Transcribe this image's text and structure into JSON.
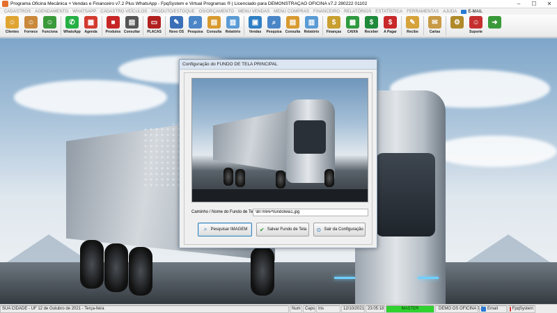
{
  "window": {
    "title": "Programa Oficina Mecânica + Vendas e Financeiro v7.2 Plus WhatsApp - FpqSystem e Virtual Programas ® | Licenciado para  DEMONSTRAÇÃO OFICINA v7.2 280222 01102",
    "minimize": "–",
    "maximize": "☐",
    "close": "✕"
  },
  "menu": [
    "CADASTROS",
    "AGENDAMENTO",
    "WHATSAPP",
    "CADASTRO VEÍCULOS",
    "PRODUTO/ESTOQUE",
    "OS/ORÇAMENTO",
    "MENU VENDAS",
    "MENU COMPRAS",
    "FINANCEIRO",
    "RELATÓRIOS",
    "ESTATÍSTICA",
    "FERRAMENTAS",
    "AJUDA"
  ],
  "menu_email": "E-MAIL",
  "toolbar": [
    {
      "label": "Clientes",
      "icon": "clients-icon",
      "color": "#e0a431",
      "glyph": "☺"
    },
    {
      "label": "Fornece",
      "icon": "supplier-icon",
      "color": "#c9883b",
      "glyph": "☺"
    },
    {
      "label": "Funciona",
      "icon": "employee-icon",
      "color": "#3a9a3a",
      "glyph": "☺"
    },
    {
      "sep": true
    },
    {
      "label": "WhatsApp",
      "icon": "whatsapp-icon",
      "color": "#25b045",
      "glyph": "✆"
    },
    {
      "label": "Agenda",
      "icon": "calendar-icon",
      "color": "#d33b2f",
      "glyph": "▦"
    },
    {
      "sep": true
    },
    {
      "label": "Produtos",
      "icon": "products-icon",
      "color": "#c72626",
      "glyph": "■"
    },
    {
      "label": "Consultar",
      "icon": "consult-icon",
      "color": "#555555",
      "glyph": "▤"
    },
    {
      "sep": true
    },
    {
      "label": "PLACAS",
      "icon": "plates-icon",
      "color": "#b22020",
      "glyph": "▭"
    },
    {
      "sep": true
    },
    {
      "label": "Novo OS",
      "icon": "new-os-icon",
      "color": "#3a6fb8",
      "glyph": "✎"
    },
    {
      "label": "Pesquisa",
      "icon": "search-icon",
      "color": "#4a86c7",
      "glyph": "⌕"
    },
    {
      "label": "Consulta",
      "icon": "consult-os-icon",
      "color": "#d89a2f",
      "glyph": "▤"
    },
    {
      "label": "Relatório",
      "icon": "report-icon",
      "color": "#5a9bd5",
      "glyph": "▥"
    },
    {
      "sep": true
    },
    {
      "label": "Vendas",
      "icon": "sales-icon",
      "color": "#2f7fc4",
      "glyph": "▣"
    },
    {
      "label": "Pesquisa",
      "icon": "search-sales-icon",
      "color": "#4a86c7",
      "glyph": "⌕"
    },
    {
      "label": "Consulta",
      "icon": "consult-sales-icon",
      "color": "#d89a2f",
      "glyph": "▤"
    },
    {
      "label": "Relatório",
      "icon": "report-sales-icon",
      "color": "#5a9bd5",
      "glyph": "▥"
    },
    {
      "sep": true
    },
    {
      "label": "Finanças",
      "icon": "finance-icon",
      "color": "#c9a030",
      "glyph": "$"
    },
    {
      "label": "CAIXA",
      "icon": "cashier-icon",
      "color": "#2f9a3f",
      "glyph": "▦"
    },
    {
      "label": "Receber",
      "icon": "receive-icon",
      "color": "#1f8a3a",
      "glyph": "$"
    },
    {
      "label": "A Pagar",
      "icon": "pay-icon",
      "color": "#c82828",
      "glyph": "$"
    },
    {
      "sep": true
    },
    {
      "label": "Recibo",
      "icon": "receipt-icon",
      "color": "#d6a23a",
      "glyph": "✎"
    },
    {
      "sep": true
    },
    {
      "label": "Cartas",
      "icon": "letters-icon",
      "color": "#c89a45",
      "glyph": "✉"
    },
    {
      "sep": true
    },
    {
      "label": "",
      "icon": "tools-icon",
      "color": "#b08a2a",
      "glyph": "⚙"
    },
    {
      "label": "Suporte",
      "icon": "support-icon",
      "color": "#c62f2f",
      "glyph": "☺"
    },
    {
      "label": "",
      "icon": "exit-icon",
      "color": "#3a9a3a",
      "glyph": "➜"
    }
  ],
  "dialog": {
    "title": "Configuração do FUNDO DE TELA PRINCIPAL",
    "path_label": "Caminho / Nome do Fundo de Tela",
    "path_value": "\\BITMAP\\fundotela1.jpg",
    "buttons": {
      "search": "Pesquisar IMAGEM",
      "save": "Salvar Fundo de Tela",
      "exit": "Sair da Configuração"
    }
  },
  "status": {
    "city": "SUA CIDADE - UF 12 de Outubro de 2021 - Terça-feira",
    "num": "Num",
    "caps": "Caps",
    "ins": "Ins",
    "date": "12/10/2021",
    "time": "23:05:18",
    "user": "MASTER",
    "company": "DEMO OS OFICINA 7.2",
    "email": "Email",
    "brand": "FpqSystem"
  }
}
